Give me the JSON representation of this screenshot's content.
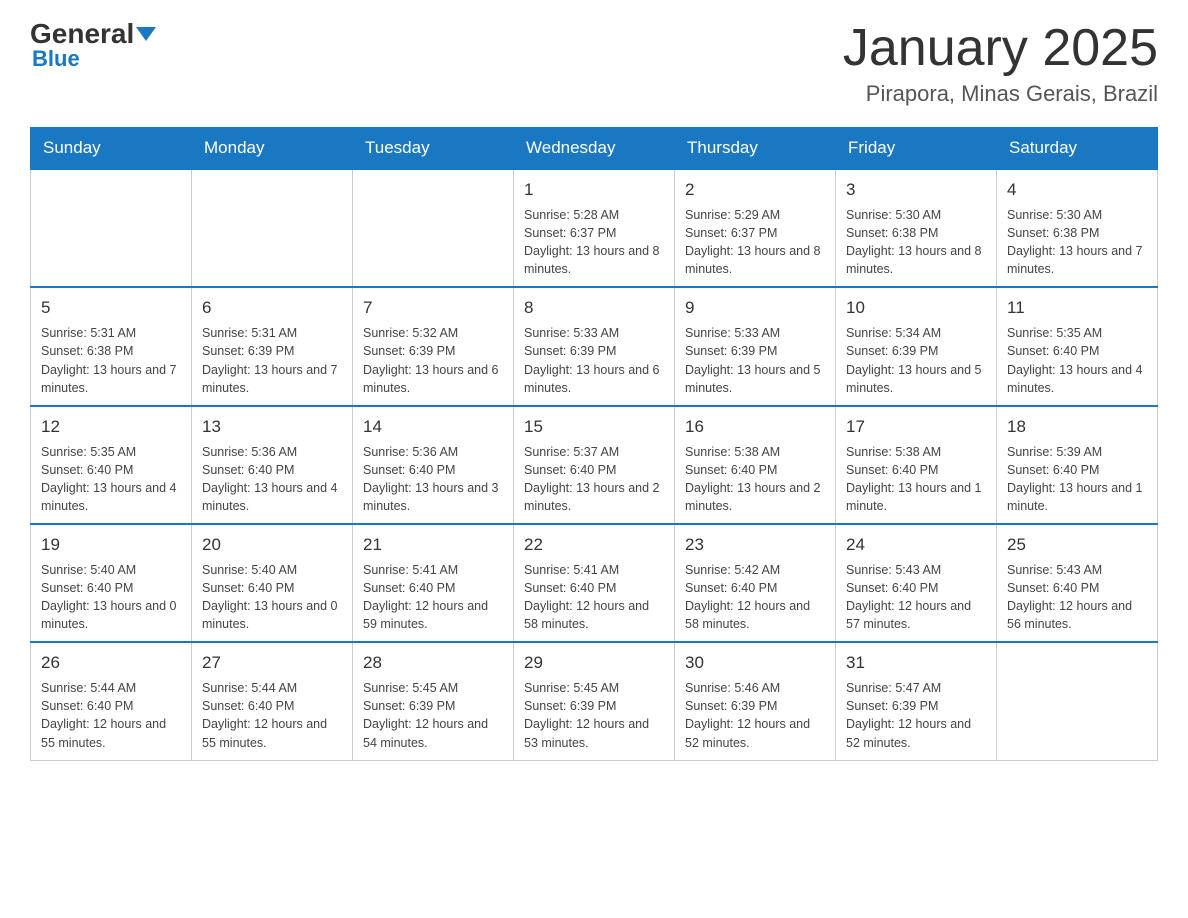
{
  "header": {
    "logo_general": "General",
    "logo_blue": "Blue",
    "title": "January 2025",
    "subtitle": "Pirapora, Minas Gerais, Brazil"
  },
  "calendar": {
    "days_of_week": [
      "Sunday",
      "Monday",
      "Tuesday",
      "Wednesday",
      "Thursday",
      "Friday",
      "Saturday"
    ],
    "weeks": [
      {
        "cells": [
          {
            "day": "",
            "info": ""
          },
          {
            "day": "",
            "info": ""
          },
          {
            "day": "",
            "info": ""
          },
          {
            "day": "1",
            "info": "Sunrise: 5:28 AM\nSunset: 6:37 PM\nDaylight: 13 hours and 8 minutes."
          },
          {
            "day": "2",
            "info": "Sunrise: 5:29 AM\nSunset: 6:37 PM\nDaylight: 13 hours and 8 minutes."
          },
          {
            "day": "3",
            "info": "Sunrise: 5:30 AM\nSunset: 6:38 PM\nDaylight: 13 hours and 8 minutes."
          },
          {
            "day": "4",
            "info": "Sunrise: 5:30 AM\nSunset: 6:38 PM\nDaylight: 13 hours and 7 minutes."
          }
        ]
      },
      {
        "cells": [
          {
            "day": "5",
            "info": "Sunrise: 5:31 AM\nSunset: 6:38 PM\nDaylight: 13 hours and 7 minutes."
          },
          {
            "day": "6",
            "info": "Sunrise: 5:31 AM\nSunset: 6:39 PM\nDaylight: 13 hours and 7 minutes."
          },
          {
            "day": "7",
            "info": "Sunrise: 5:32 AM\nSunset: 6:39 PM\nDaylight: 13 hours and 6 minutes."
          },
          {
            "day": "8",
            "info": "Sunrise: 5:33 AM\nSunset: 6:39 PM\nDaylight: 13 hours and 6 minutes."
          },
          {
            "day": "9",
            "info": "Sunrise: 5:33 AM\nSunset: 6:39 PM\nDaylight: 13 hours and 5 minutes."
          },
          {
            "day": "10",
            "info": "Sunrise: 5:34 AM\nSunset: 6:39 PM\nDaylight: 13 hours and 5 minutes."
          },
          {
            "day": "11",
            "info": "Sunrise: 5:35 AM\nSunset: 6:40 PM\nDaylight: 13 hours and 4 minutes."
          }
        ]
      },
      {
        "cells": [
          {
            "day": "12",
            "info": "Sunrise: 5:35 AM\nSunset: 6:40 PM\nDaylight: 13 hours and 4 minutes."
          },
          {
            "day": "13",
            "info": "Sunrise: 5:36 AM\nSunset: 6:40 PM\nDaylight: 13 hours and 4 minutes."
          },
          {
            "day": "14",
            "info": "Sunrise: 5:36 AM\nSunset: 6:40 PM\nDaylight: 13 hours and 3 minutes."
          },
          {
            "day": "15",
            "info": "Sunrise: 5:37 AM\nSunset: 6:40 PM\nDaylight: 13 hours and 2 minutes."
          },
          {
            "day": "16",
            "info": "Sunrise: 5:38 AM\nSunset: 6:40 PM\nDaylight: 13 hours and 2 minutes."
          },
          {
            "day": "17",
            "info": "Sunrise: 5:38 AM\nSunset: 6:40 PM\nDaylight: 13 hours and 1 minute."
          },
          {
            "day": "18",
            "info": "Sunrise: 5:39 AM\nSunset: 6:40 PM\nDaylight: 13 hours and 1 minute."
          }
        ]
      },
      {
        "cells": [
          {
            "day": "19",
            "info": "Sunrise: 5:40 AM\nSunset: 6:40 PM\nDaylight: 13 hours and 0 minutes."
          },
          {
            "day": "20",
            "info": "Sunrise: 5:40 AM\nSunset: 6:40 PM\nDaylight: 13 hours and 0 minutes."
          },
          {
            "day": "21",
            "info": "Sunrise: 5:41 AM\nSunset: 6:40 PM\nDaylight: 12 hours and 59 minutes."
          },
          {
            "day": "22",
            "info": "Sunrise: 5:41 AM\nSunset: 6:40 PM\nDaylight: 12 hours and 58 minutes."
          },
          {
            "day": "23",
            "info": "Sunrise: 5:42 AM\nSunset: 6:40 PM\nDaylight: 12 hours and 58 minutes."
          },
          {
            "day": "24",
            "info": "Sunrise: 5:43 AM\nSunset: 6:40 PM\nDaylight: 12 hours and 57 minutes."
          },
          {
            "day": "25",
            "info": "Sunrise: 5:43 AM\nSunset: 6:40 PM\nDaylight: 12 hours and 56 minutes."
          }
        ]
      },
      {
        "cells": [
          {
            "day": "26",
            "info": "Sunrise: 5:44 AM\nSunset: 6:40 PM\nDaylight: 12 hours and 55 minutes."
          },
          {
            "day": "27",
            "info": "Sunrise: 5:44 AM\nSunset: 6:40 PM\nDaylight: 12 hours and 55 minutes."
          },
          {
            "day": "28",
            "info": "Sunrise: 5:45 AM\nSunset: 6:39 PM\nDaylight: 12 hours and 54 minutes."
          },
          {
            "day": "29",
            "info": "Sunrise: 5:45 AM\nSunset: 6:39 PM\nDaylight: 12 hours and 53 minutes."
          },
          {
            "day": "30",
            "info": "Sunrise: 5:46 AM\nSunset: 6:39 PM\nDaylight: 12 hours and 52 minutes."
          },
          {
            "day": "31",
            "info": "Sunrise: 5:47 AM\nSunset: 6:39 PM\nDaylight: 12 hours and 52 minutes."
          },
          {
            "day": "",
            "info": ""
          }
        ]
      }
    ]
  }
}
